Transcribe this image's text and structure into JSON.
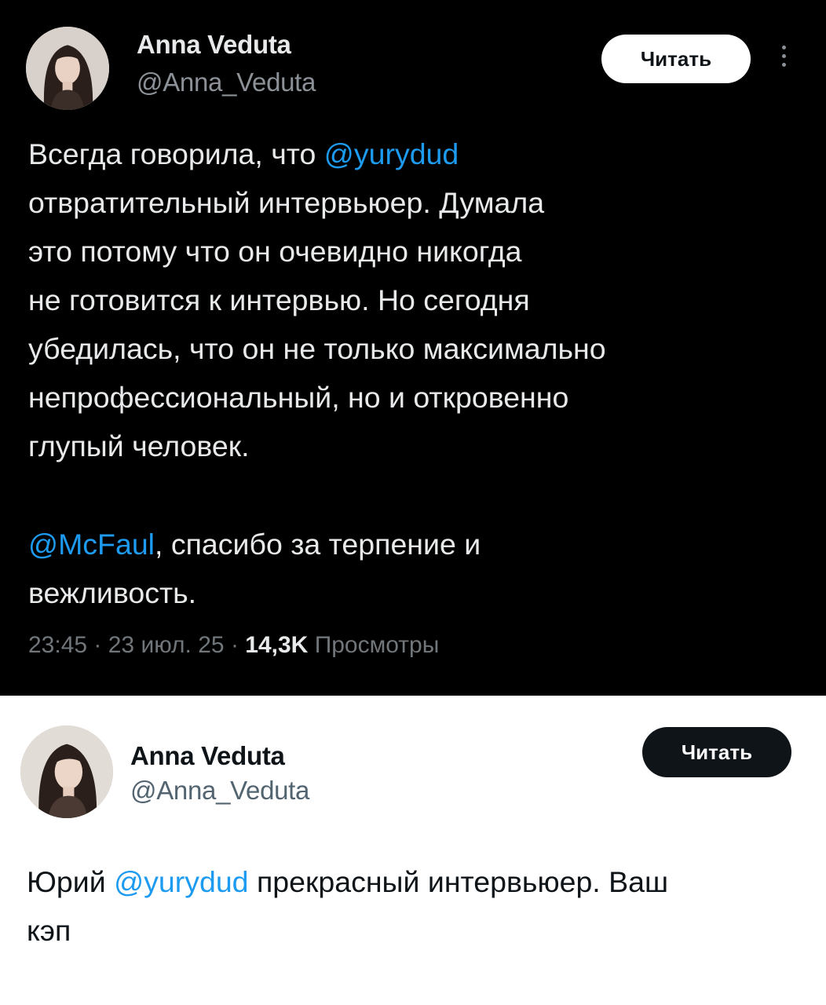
{
  "tweet1": {
    "author_name": "Anna Veduta",
    "author_handle": "@Anna_Veduta",
    "follow_label": "Читать",
    "more_icon": "more-vertical-icon",
    "paragraph1": {
      "line1_prefix": "Всегда говорила, что ",
      "line1_mention": "@yurydud",
      "line2": "отвратительный интервьюер. Думала",
      "line3": "это потому что он очевидно никогда",
      "line4": "не готовится к интервью. Но сегодня",
      "line5": "убедилась, что он не только максимально",
      "line6": "непрофессиональный, но и откровенно",
      "line7": "глупый человек."
    },
    "paragraph2": {
      "line1_mention": "@McFaul",
      "line1_suffix": ", спасибо за терпение и",
      "line2": "вежливость."
    },
    "time": "23:45",
    "date": "23 июл. 25",
    "views_count": "14,3K",
    "views_label": "Просмотры",
    "separator": " · "
  },
  "tweet2": {
    "author_name": "Anna Veduta",
    "author_handle": "@Anna_Veduta",
    "follow_label": "Читать",
    "text": {
      "line1_prefix": "Юрий ",
      "line1_mention": "@yurydud",
      "line1_suffix": " прекрасный интервьюер. Ваш",
      "line2": "кэп"
    }
  },
  "colors": {
    "dark_bg": "#000000",
    "light_bg": "#ffffff",
    "mention": "#1d9bf0",
    "muted_dark": "#71767b",
    "muted_light": "#536471"
  }
}
